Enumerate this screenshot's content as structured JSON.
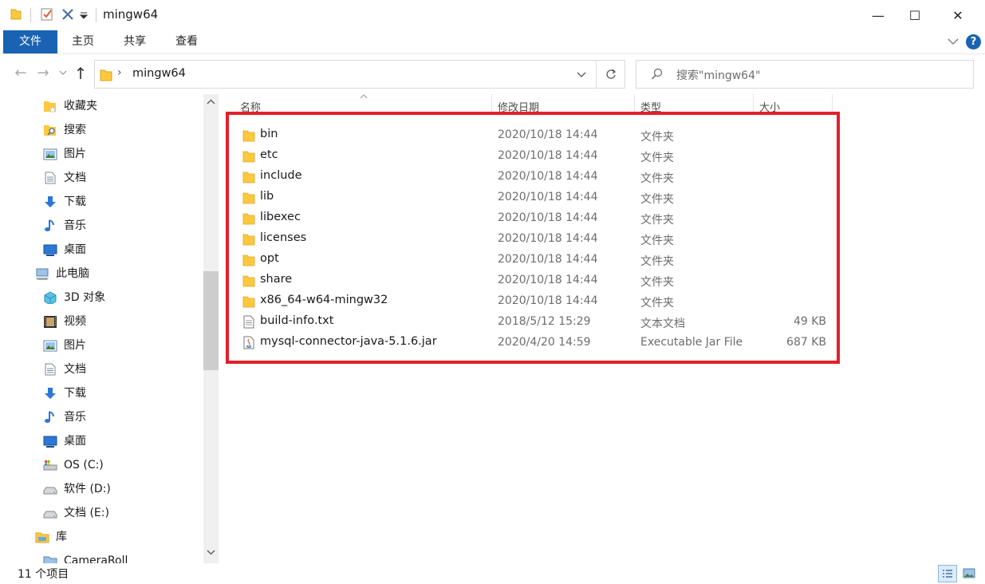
{
  "window": {
    "title": "mingw64",
    "minimize_glyph": "—",
    "maximize_glyph": "☐",
    "close_glyph": "✕"
  },
  "ribbon": {
    "tabs": [
      {
        "label": "文件",
        "active": true
      },
      {
        "label": "主页",
        "active": false
      },
      {
        "label": "共享",
        "active": false
      },
      {
        "label": "查看",
        "active": false
      }
    ],
    "help_glyph": "?"
  },
  "address": {
    "path_segment": "mingw64",
    "separator": "›"
  },
  "search": {
    "placeholder": "搜索\"mingw64\""
  },
  "sidebar": {
    "items": [
      {
        "label": "收藏夹",
        "icon": "star-folder-icon"
      },
      {
        "label": "搜索",
        "icon": "search-folder-icon"
      },
      {
        "label": "图片",
        "icon": "pictures-icon"
      },
      {
        "label": "文档",
        "icon": "documents-icon"
      },
      {
        "label": "下载",
        "icon": "downloads-icon"
      },
      {
        "label": "音乐",
        "icon": "music-icon"
      },
      {
        "label": "桌面",
        "icon": "desktop-icon"
      },
      {
        "label": "此电脑",
        "icon": "this-pc-icon"
      },
      {
        "label": "3D 对象",
        "icon": "3d-objects-icon"
      },
      {
        "label": "视频",
        "icon": "videos-icon"
      },
      {
        "label": "图片",
        "icon": "pictures-icon"
      },
      {
        "label": "文档",
        "icon": "documents-icon"
      },
      {
        "label": "下载",
        "icon": "downloads-icon"
      },
      {
        "label": "音乐",
        "icon": "music-icon"
      },
      {
        "label": "桌面",
        "icon": "desktop-icon"
      },
      {
        "label": "OS (C:)",
        "icon": "os-drive-icon"
      },
      {
        "label": "软件 (D:)",
        "icon": "drive-icon"
      },
      {
        "label": "文档 (E:)",
        "icon": "drive-icon"
      },
      {
        "label": "库",
        "icon": "library-icon"
      },
      {
        "label": "CameraRoll",
        "icon": "folder-icon"
      }
    ]
  },
  "columns": {
    "name": "名称",
    "date": "修改日期",
    "type": "类型",
    "size": "大小"
  },
  "files": [
    {
      "name": "bin",
      "date": "2020/10/18 14:44",
      "type": "文件夹",
      "size": "",
      "kind": "folder"
    },
    {
      "name": "etc",
      "date": "2020/10/18 14:44",
      "type": "文件夹",
      "size": "",
      "kind": "folder"
    },
    {
      "name": "include",
      "date": "2020/10/18 14:44",
      "type": "文件夹",
      "size": "",
      "kind": "folder"
    },
    {
      "name": "lib",
      "date": "2020/10/18 14:44",
      "type": "文件夹",
      "size": "",
      "kind": "folder"
    },
    {
      "name": "libexec",
      "date": "2020/10/18 14:44",
      "type": "文件夹",
      "size": "",
      "kind": "folder"
    },
    {
      "name": "licenses",
      "date": "2020/10/18 14:44",
      "type": "文件夹",
      "size": "",
      "kind": "folder"
    },
    {
      "name": "opt",
      "date": "2020/10/18 14:44",
      "type": "文件夹",
      "size": "",
      "kind": "folder"
    },
    {
      "name": "share",
      "date": "2020/10/18 14:44",
      "type": "文件夹",
      "size": "",
      "kind": "folder"
    },
    {
      "name": "x86_64-w64-mingw32",
      "date": "2020/10/18 14:44",
      "type": "文件夹",
      "size": "",
      "kind": "folder"
    },
    {
      "name": "build-info.txt",
      "date": "2018/5/12 15:29",
      "type": "文本文档",
      "size": "49 KB",
      "kind": "text"
    },
    {
      "name": "mysql-connector-java-5.1.6.jar",
      "date": "2020/4/20 14:59",
      "type": "Executable Jar File",
      "size": "687 KB",
      "kind": "jar"
    }
  ],
  "status": {
    "item_count": "11 个项目"
  },
  "colors": {
    "accent": "#1a62b3",
    "highlight": "#e3202a",
    "folder": "#ffc83d"
  }
}
